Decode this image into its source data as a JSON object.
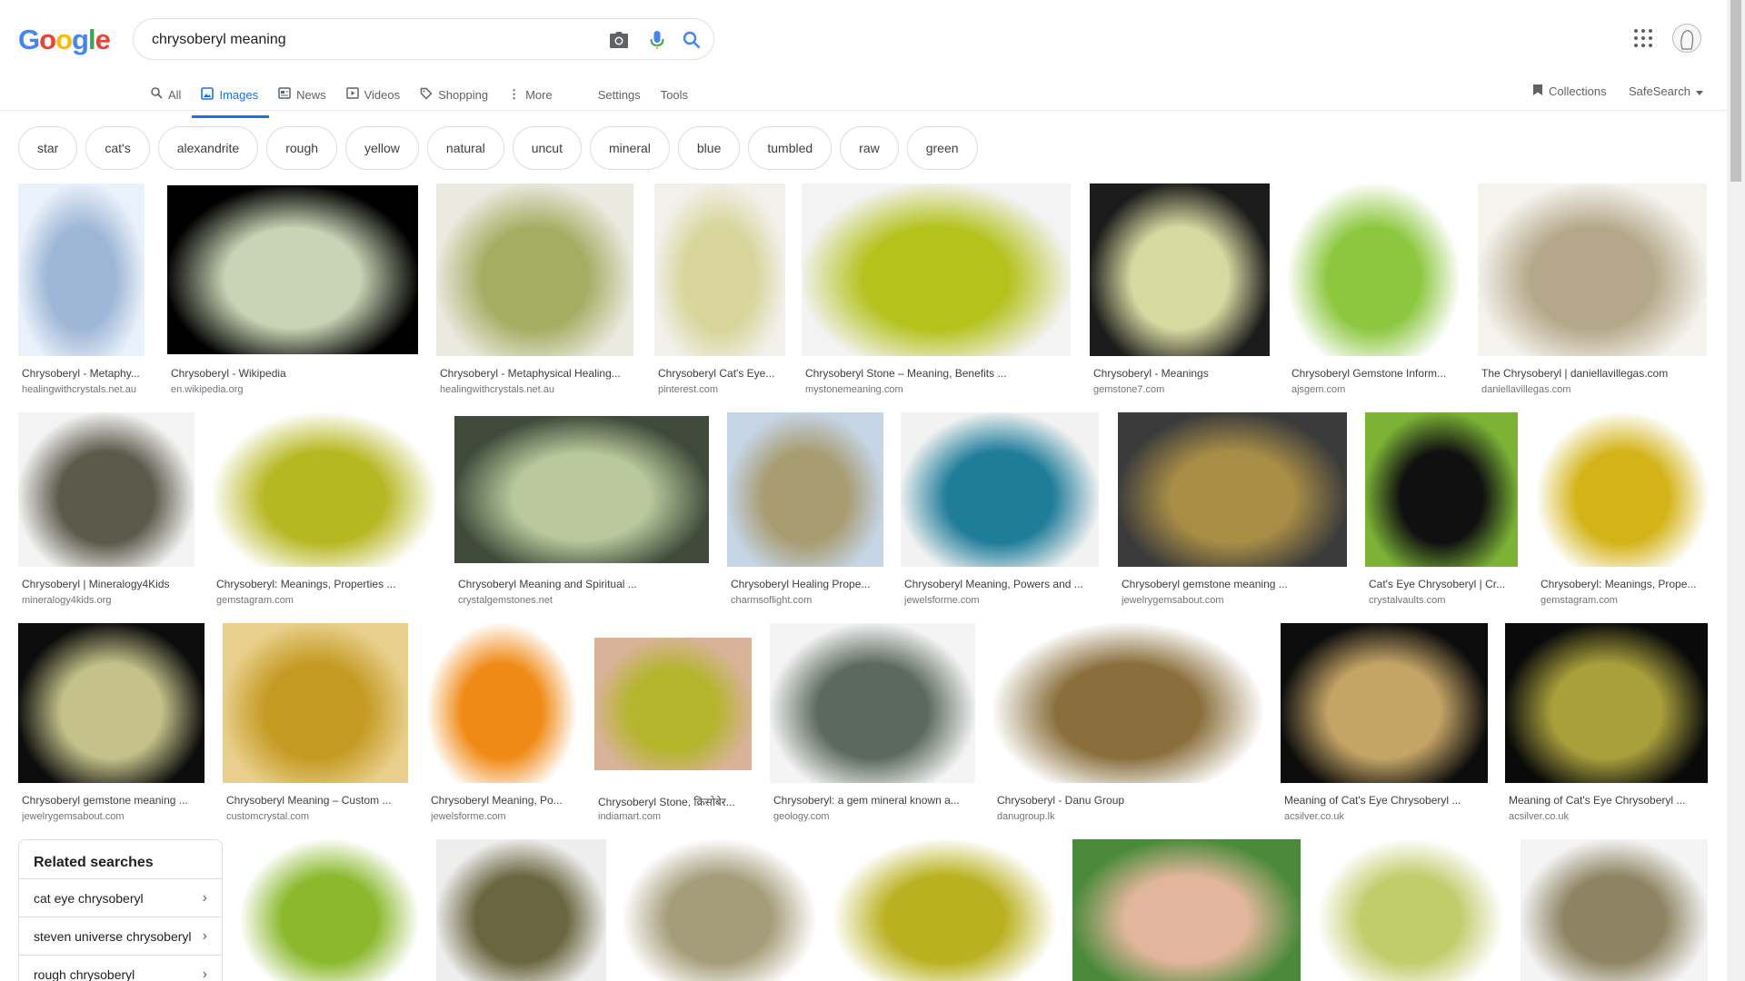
{
  "logo": {
    "letters": [
      "G",
      "o",
      "o",
      "g",
      "l",
      "e"
    ],
    "colors": [
      "#4285f4",
      "#ea4335",
      "#fbbc05",
      "#4285f4",
      "#34a853",
      "#ea4335"
    ]
  },
  "search": {
    "query": "chrysoberyl meaning"
  },
  "nav": {
    "tabs": [
      {
        "label": "All",
        "icon": "search-icon"
      },
      {
        "label": "Images",
        "icon": "image-icon",
        "active": true
      },
      {
        "label": "News",
        "icon": "news-icon"
      },
      {
        "label": "Videos",
        "icon": "video-icon"
      },
      {
        "label": "Shopping",
        "icon": "tag-icon"
      },
      {
        "label": "More",
        "icon": "more-vert-icon"
      }
    ],
    "settings": "Settings",
    "tools": "Tools",
    "collections": "Collections",
    "safesearch": "SafeSearch"
  },
  "chips": [
    "star",
    "cat's",
    "alexandrite",
    "rough",
    "yellow",
    "natural",
    "uncut",
    "mineral",
    "blue",
    "tumbled",
    "raw",
    "green"
  ],
  "results": [
    {
      "title": "Chrysoberyl - Metaphy...",
      "source": "healingwithcrystals.net.au",
      "colors": [
        "#e9f1fb",
        "#9fb7d6"
      ]
    },
    {
      "title": "Chrysoberyl - Wikipedia",
      "source": "en.wikipedia.org",
      "colors": [
        "#000000",
        "#c9d3b5"
      ]
    },
    {
      "title": "Chrysoberyl - Metaphysical Healing...",
      "source": "healingwithcrystals.net.au",
      "colors": [
        "#eaeae0",
        "#a5ad63"
      ]
    },
    {
      "title": "Chrysoberyl Cat's Eye...",
      "source": "pinterest.com",
      "colors": [
        "#f2f0ea",
        "#d7d59a"
      ]
    },
    {
      "title": "Chrysoberyl Stone – Meaning, Benefits ...",
      "source": "mystonemeaning.com",
      "colors": [
        "#f3f3f3",
        "#b4c21c"
      ]
    },
    {
      "title": "Chrysoberyl - Meanings",
      "source": "gemstone7.com",
      "colors": [
        "#1b1b1b",
        "#d7d9a1"
      ]
    },
    {
      "title": "Chrysoberyl Gemstone Inform...",
      "source": "ajsgem.com",
      "colors": [
        "#ffffff",
        "#8dc73f"
      ]
    },
    {
      "title": "The Chrysoberyl | daniellavillegas.com",
      "source": "daniellavillegas.com",
      "colors": [
        "#f5f3ee",
        "#b5a88a"
      ]
    },
    {
      "title": "Chrysoberyl | Mineralogy4Kids",
      "source": "mineralogy4kids.org",
      "colors": [
        "#f3f3f3",
        "#5c5a4a"
      ]
    },
    {
      "title": "Chrysoberyl: Meanings, Properties ...",
      "source": "gemstagram.com",
      "colors": [
        "#ffffff",
        "#b7b722"
      ]
    },
    {
      "title": "Chrysoberyl Meaning and Spiritual ...",
      "source": "crystalgemstones.net",
      "colors": [
        "#3f4a3a",
        "#b9c99c"
      ]
    },
    {
      "title": "Chrysoberyl Healing Prope...",
      "source": "charmsoflight.com",
      "colors": [
        "#c6d5e6",
        "#a89c72"
      ]
    },
    {
      "title": "Chrysoberyl Meaning, Powers and ...",
      "source": "jewelsforme.com",
      "colors": [
        "#f2f2f2",
        "#1f7d9a"
      ]
    },
    {
      "title": "Chrysoberyl gemstone meaning ...",
      "source": "jewelrygemsabout.com",
      "colors": [
        "#3b3b3b",
        "#a88d46"
      ]
    },
    {
      "title": "Cat's Eye Chrysoberyl | Cr...",
      "source": "crystalvaults.com",
      "colors": [
        "#7cb336",
        "#101010"
      ]
    },
    {
      "title": "Chrysoberyl: Meanings, Prope...",
      "source": "gemstagram.com",
      "colors": [
        "#ffffff",
        "#d3b317"
      ]
    },
    {
      "title": "Chrysoberyl gemstone meaning ...",
      "source": "jewelrygemsabout.com",
      "colors": [
        "#0c0c0c",
        "#c4c28a"
      ]
    },
    {
      "title": "Chrysoberyl Meaning – Custom ...",
      "source": "customcrystal.com",
      "colors": [
        "#e8cf8b",
        "#c49a23"
      ]
    },
    {
      "title": "Chrysoberyl Meaning, Po...",
      "source": "jewelsforme.com",
      "colors": [
        "#ffffff",
        "#f08a16"
      ]
    },
    {
      "title": "Chrysoberyl Stone, क्रिसोबेर...",
      "source": "indiamart.com",
      "colors": [
        "#d8b398",
        "#b4b52a"
      ]
    },
    {
      "title": "Chrysoberyl: a gem mineral known a...",
      "source": "geology.com",
      "colors": [
        "#f4f4f4",
        "#5c6a5e"
      ]
    },
    {
      "title": "Chrysoberyl - Danu Group",
      "source": "danugroup.lk",
      "colors": [
        "#ffffff",
        "#8a6f3d"
      ]
    },
    {
      "title": "Meaning of Cat's Eye Chrysoberyl ...",
      "source": "acsilver.co.uk",
      "colors": [
        "#0c0c0c",
        "#c5a566"
      ]
    },
    {
      "title": "Meaning of Cat's Eye Chrysoberyl ...",
      "source": "acsilver.co.uk",
      "colors": [
        "#0a0a0a",
        "#a9a03c"
      ]
    },
    {
      "title": "",
      "source": "",
      "colors": [
        "#ffffff",
        "#8bb92e"
      ]
    },
    {
      "title": "",
      "source": "",
      "colors": [
        "#eeeeee",
        "#6a6640"
      ]
    },
    {
      "title": "",
      "source": "",
      "colors": [
        "#ffffff",
        "#a59c7a"
      ]
    },
    {
      "title": "",
      "source": "",
      "colors": [
        "#ffffff",
        "#b9b11f"
      ]
    },
    {
      "title": "",
      "source": "",
      "colors": [
        "#4a8a3a",
        "#e2b69c"
      ]
    },
    {
      "title": "",
      "source": "",
      "colors": [
        "#ffffff",
        "#c1cc6b"
      ]
    },
    {
      "title": "",
      "source": "",
      "colors": [
        "#f4f4f4",
        "#8e8463"
      ]
    }
  ],
  "related": {
    "heading": "Related searches",
    "items": [
      "cat eye chrysoberyl",
      "steven universe chrysoberyl",
      "rough chrysoberyl"
    ]
  }
}
